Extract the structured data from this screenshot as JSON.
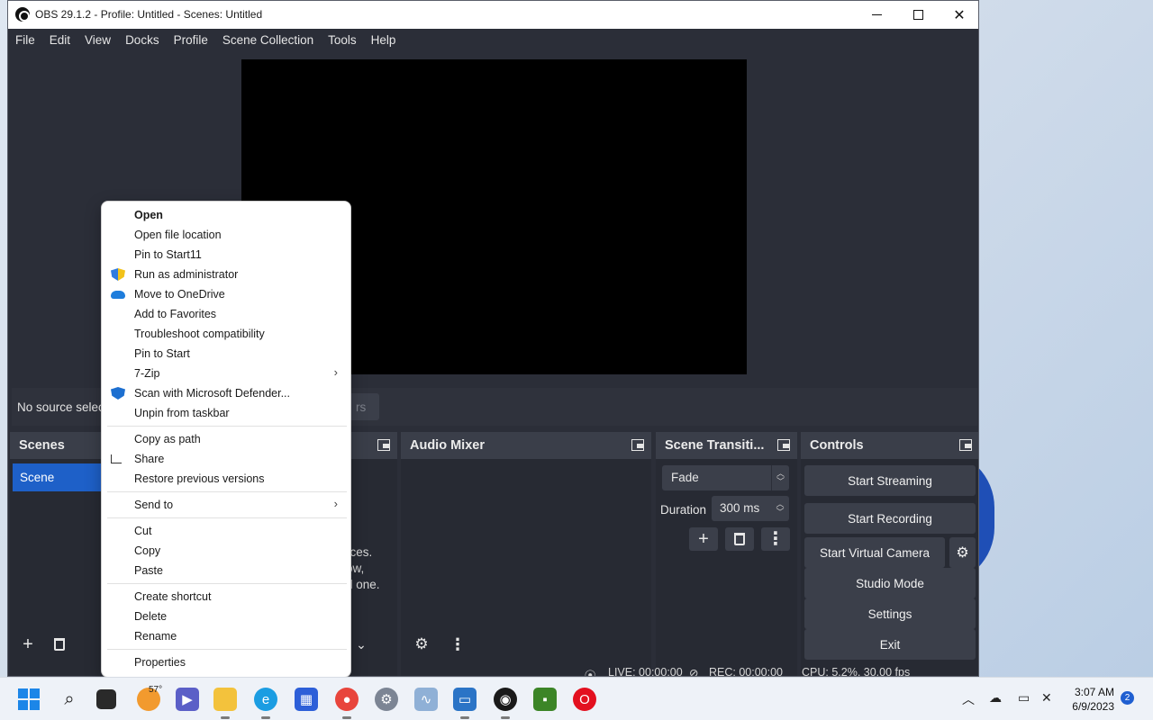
{
  "window": {
    "title": "OBS 29.1.2 - Profile: Untitled - Scenes: Untitled"
  },
  "menu": [
    "File",
    "Edit",
    "View",
    "Docks",
    "Profile",
    "Scene Collection",
    "Tools",
    "Help"
  ],
  "source_bar": {
    "no_source_text": "No source selec",
    "filters_partial": "rs"
  },
  "docks": {
    "scenes": {
      "title": "Scenes",
      "items": [
        "Scene"
      ]
    },
    "sources": {
      "hint_lines": [
        "rces.",
        "ow,",
        "d one."
      ]
    },
    "audio_mixer": {
      "title": "Audio Mixer"
    },
    "transitions": {
      "title": "Scene Transiti...",
      "selected": "Fade",
      "duration_label": "Duration",
      "duration_value": "300 ms"
    },
    "controls": {
      "title": "Controls",
      "buttons": [
        "Start Streaming",
        "Start Recording",
        "Start Virtual Camera",
        "Studio Mode",
        "Settings",
        "Exit"
      ]
    }
  },
  "status": {
    "live": "LIVE: 00:00:00",
    "rec": "REC: 00:00:00",
    "cpu": "CPU: 5.2%, 30.00 fps"
  },
  "context_menu": {
    "items": [
      {
        "label": "Open",
        "bold": true
      },
      {
        "label": "Open file location"
      },
      {
        "label": "Pin to Start11"
      },
      {
        "label": "Run as administrator",
        "icon": "uac-shield-icon"
      },
      {
        "label": "Move to OneDrive",
        "icon": "onedrive-icon"
      },
      {
        "label": "Add to Favorites"
      },
      {
        "label": "Troubleshoot compatibility"
      },
      {
        "label": "Pin to Start"
      },
      {
        "label": "7-Zip",
        "submenu": true
      },
      {
        "label": "Scan with Microsoft Defender...",
        "icon": "defender-icon"
      },
      {
        "label": "Unpin from taskbar"
      },
      {
        "label": "Copy as path"
      },
      {
        "label": "Share",
        "icon": "share-icon"
      },
      {
        "label": "Restore previous versions"
      },
      {
        "label": "Send to",
        "submenu": true
      },
      {
        "label": "Cut"
      },
      {
        "label": "Copy"
      },
      {
        "label": "Paste"
      },
      {
        "label": "Create shortcut"
      },
      {
        "label": "Delete"
      },
      {
        "label": "Rename"
      },
      {
        "label": "Properties"
      }
    ]
  },
  "taskbar": {
    "weather_temp": "57°",
    "clock_time": "3:07 AM",
    "clock_date": "6/9/2023",
    "notifications": "2",
    "apps": [
      "start-icon",
      "search-icon",
      "task-view-icon",
      "weather-icon",
      "teams-icon",
      "file-explorer-icon",
      "edge-icon",
      "store-icon",
      "chrome-icon",
      "settings-icon",
      "photos-icon",
      "window-app-icon",
      "obs-icon",
      "minecraft-icon",
      "opera-icon"
    ]
  },
  "colors": {
    "obs_bg": "#2b2e38",
    "dock_header": "#3a3e49",
    "button": "#3b3f4a",
    "selection": "#1e60c8"
  }
}
